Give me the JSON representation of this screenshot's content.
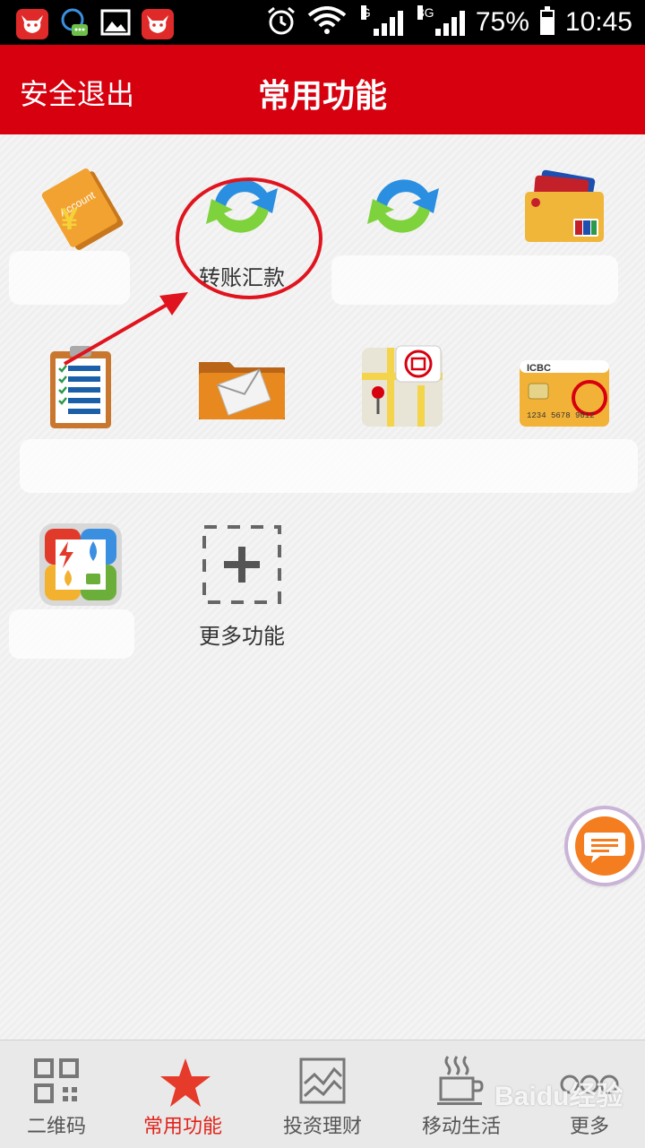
{
  "status_bar": {
    "battery": "75%",
    "time": "10:45",
    "signal1_tag": "G",
    "signal2_tag": "3G",
    "icons": [
      "app-bull-icon",
      "chat-bubble-icon",
      "image-icon",
      "app-bull-icon",
      "alarm-icon",
      "wifi-icon",
      "signal-icon",
      "signal-icon",
      "battery-icon"
    ]
  },
  "header": {
    "logout_label": "安全退出",
    "title": "常用功能",
    "background": "#d7000f"
  },
  "tiles": [
    {
      "label": "",
      "icon": "account-book-icon"
    },
    {
      "label": "转账汇款",
      "icon": "transfer-arrows-icon"
    },
    {
      "label": "",
      "icon": "refresh-arrows-icon"
    },
    {
      "label": "",
      "icon": "bank-cards-icon"
    },
    {
      "label": "",
      "icon": "clipboard-checklist-icon"
    },
    {
      "label": "",
      "icon": "mail-folder-icon"
    },
    {
      "label": "",
      "icon": "map-pin-icon"
    },
    {
      "label": "",
      "icon": "icbc-card-icon"
    },
    {
      "label": "",
      "icon": "utilities-icon"
    },
    {
      "label": "更多功能",
      "icon": "add-plus-icon"
    }
  ],
  "bottom_nav": [
    {
      "label": "二维码",
      "icon": "qr-code-icon",
      "active": false
    },
    {
      "label": "常用功能",
      "icon": "star-icon",
      "active": true
    },
    {
      "label": "投资理财",
      "icon": "chart-icon",
      "active": false
    },
    {
      "label": "移动生活",
      "icon": "coffee-cup-icon",
      "active": false
    },
    {
      "label": "更多",
      "icon": "more-dots-icon",
      "active": false
    }
  ],
  "watermark": "Baidu经验",
  "colors": {
    "accent": "#e2231a",
    "annotation": "#e0141e",
    "chat_fab": "#f47d20"
  }
}
